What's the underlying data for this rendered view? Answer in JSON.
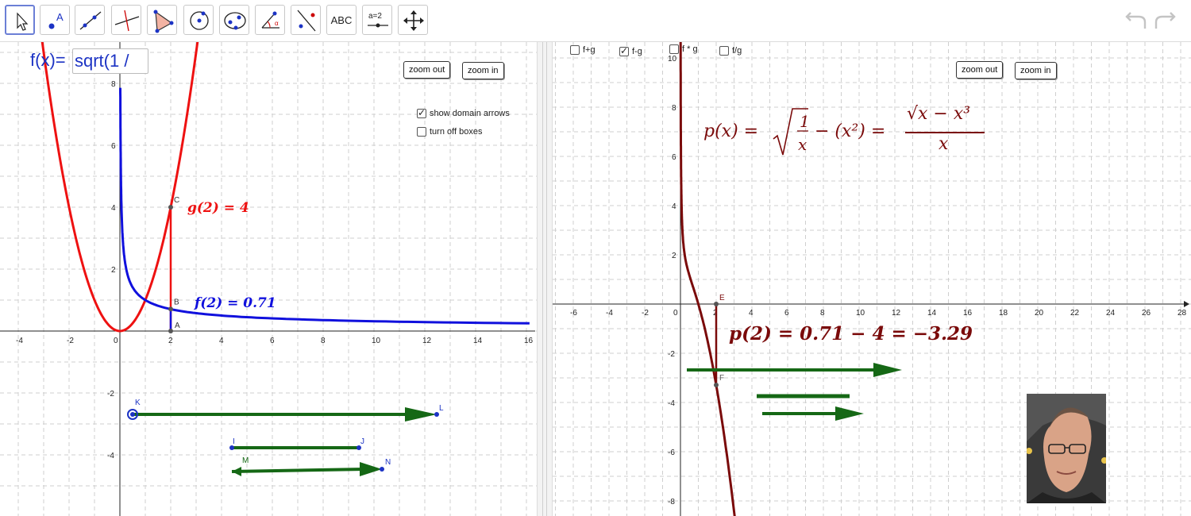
{
  "toolbar": {
    "tools": [
      {
        "name": "move-tool",
        "icon": "arrow-cursor-icon",
        "active": true
      },
      {
        "name": "point-tool",
        "icon": "point-icon",
        "label": "A"
      },
      {
        "name": "line-tool",
        "icon": "line-icon"
      },
      {
        "name": "perpendicular-tool",
        "icon": "perpendicular-line-icon"
      },
      {
        "name": "polygon-tool",
        "icon": "polygon-icon"
      },
      {
        "name": "circle-tool",
        "icon": "circle-center-icon"
      },
      {
        "name": "conic-tool",
        "icon": "ellipse-icon"
      },
      {
        "name": "angle-tool",
        "icon": "angle-icon"
      },
      {
        "name": "reflect-tool",
        "icon": "reflect-icon"
      },
      {
        "name": "text-tool",
        "icon": "text-icon",
        "label": "ABC"
      },
      {
        "name": "slider-tool",
        "icon": "slider-icon",
        "label": "a=2"
      },
      {
        "name": "move-view-tool",
        "icon": "move-graphics-view-icon"
      }
    ],
    "undo_icon": "undo-icon",
    "redo_icon": "redo-icon"
  },
  "left_view": {
    "input_label": "f(x)=",
    "input_value": "sqrt(1 /",
    "zoom_out": "zoom out",
    "zoom_in": "zoom in",
    "checkbox_domain": {
      "label": "show domain arrows",
      "checked": true
    },
    "checkbox_boxes": {
      "label": "turn off boxes",
      "checked": false
    },
    "x_ticks": [
      "-4",
      "-2",
      "0",
      "2",
      "4",
      "6",
      "8",
      "10",
      "12",
      "14",
      "16"
    ],
    "y_ticks": [
      "8",
      "6",
      "4",
      "2",
      "-2",
      "-4"
    ],
    "g_label": "g(2) = 4",
    "f_label": "f(2) = 0.71",
    "points": [
      "A",
      "B",
      "C",
      "K",
      "L",
      "I",
      "J",
      "M",
      "N"
    ]
  },
  "right_view": {
    "checkboxes": [
      {
        "label": "f+g",
        "checked": false
      },
      {
        "label": "f-g",
        "checked": true
      },
      {
        "label": "f * g",
        "checked": false
      },
      {
        "label": "f/g",
        "checked": false
      }
    ],
    "zoom_out": "zoom out",
    "zoom_in": "zoom in",
    "formula": {
      "lhs": "p(x) =",
      "mid": "− (x²) =",
      "num": "√x − x³",
      "den": "x",
      "frac_num": "1",
      "frac_den": "x"
    },
    "p_label": "p(2) = 0.71 − 4 = −3.29",
    "x_ticks": [
      "-6",
      "-4",
      "-2",
      "0",
      "2",
      "4",
      "6",
      "8",
      "10",
      "12",
      "14",
      "16",
      "18",
      "20",
      "22",
      "24",
      "26",
      "28"
    ],
    "y_ticks": [
      "10",
      "8",
      "6",
      "4",
      "2",
      "-2",
      "-4",
      "-6",
      "-8"
    ],
    "points": [
      "E",
      "F"
    ],
    "photo": "portrait-photo"
  },
  "colors": {
    "f": "#1010dd",
    "g": "#ee1111",
    "p": "#7a0a0a",
    "arrow": "#156815"
  }
}
